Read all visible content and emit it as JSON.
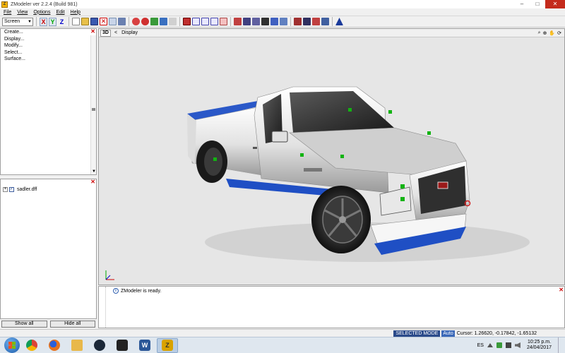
{
  "window": {
    "title": "ZModeler ver 2.2.4 (Build 981)",
    "app_icon": "Z",
    "minimize": "–",
    "maximize": "□",
    "close": "✕"
  },
  "menu": [
    "File",
    "View",
    "Options",
    "Edit",
    "Help"
  ],
  "toolbar": {
    "screen_select": "Screen",
    "axis_x": "X",
    "axis_y": "Y",
    "axis_z": "Z"
  },
  "commands": {
    "items": [
      "Create...",
      "Display...",
      "Modify...",
      "Select...",
      "Surface..."
    ]
  },
  "scene": {
    "expand": "+",
    "check": "✓",
    "node": "sadler.dff"
  },
  "buttons": {
    "show_all": "Show all",
    "hide_all": "Hide all"
  },
  "viewport": {
    "mode": "3D",
    "nav_arrow": "<",
    "title": "Display",
    "icons": [
      "magnifier-icon",
      "zoom-icon",
      "hand-icon",
      "rotate-icon"
    ]
  },
  "log": {
    "icon": "i",
    "message": "ZModeler is ready."
  },
  "status": {
    "mode": "SELECTED MODE",
    "auto": "Auto",
    "cursor": "Cursor: 1.26620, -0.17842, -1.65132"
  },
  "taskbar": {
    "apps": [
      {
        "name": "chrome",
        "glyph": "",
        "color": "#3a9f4a"
      },
      {
        "name": "firefox",
        "glyph": "",
        "color": "#e8731e"
      },
      {
        "name": "explorer",
        "glyph": "",
        "color": "#e8b84a"
      },
      {
        "name": "steam",
        "glyph": "",
        "color": "#1b2838"
      },
      {
        "name": "bethesda",
        "glyph": "",
        "color": "#222222"
      },
      {
        "name": "word",
        "glyph": "W",
        "color": "#2b5797"
      },
      {
        "name": "zmodeler",
        "glyph": "Z",
        "color": "#d9a200"
      }
    ],
    "lang": "ES",
    "time": "10:25 p.m.",
    "date": "24/04/2017"
  },
  "colors": {
    "close_red": "#c42b1c",
    "status_mode_bg": "#2a4a8a",
    "car_body": "#e8e8e8",
    "car_accent": "#1f4fc4"
  }
}
